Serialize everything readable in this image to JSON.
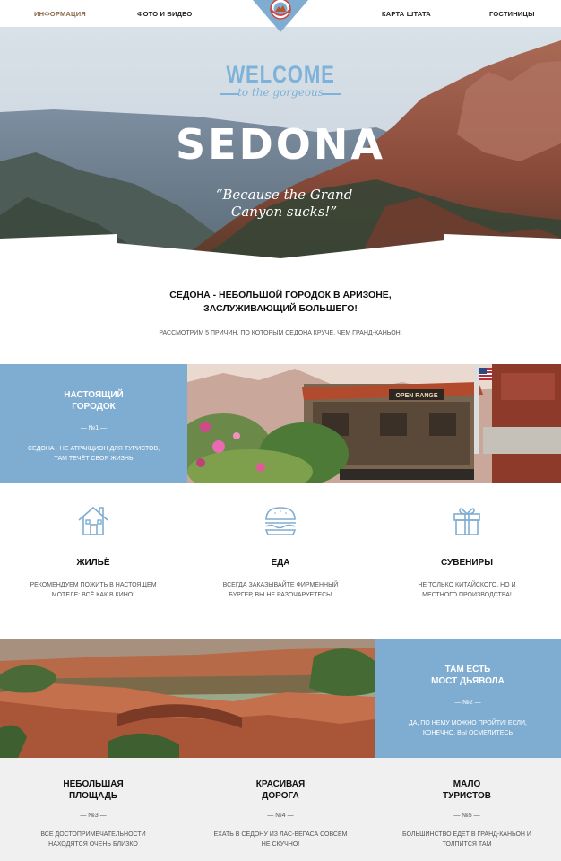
{
  "nav": {
    "items": [
      {
        "label": "ИНФОРМАЦИЯ",
        "active": true
      },
      {
        "label": "ФОТО И ВИДЕО",
        "active": false
      },
      {
        "label": "КАРТА ШТАТА",
        "active": false
      },
      {
        "label": "ГОСТИНИЦЫ",
        "active": false
      }
    ]
  },
  "hero": {
    "welcome": "WELCOME",
    "subtitle": "to the gorgeous",
    "title": "SEDONA",
    "quote": "“Because the Grand Canyon sucks!”"
  },
  "intro": {
    "title_line1": "СЕДОНА - НЕБОЛЬШОЙ ГОРОДОК В АРИЗОНЕ,",
    "title_line2": "ЗАСЛУЖИВАЮЩИЙ БОЛЬШЕГО!",
    "subtitle": "РАССМОТРИМ 5 ПРИЧИН, ПО КОТОРЫМ СЕДОНА КРУЧЕ, ЧЕМ ГРАНД-КАНЬОН!"
  },
  "reason1": {
    "title_line1": "НАСТОЯЩИЙ",
    "title_line2": "ГОРОДОК",
    "number": "— №1 —",
    "text_line1": "СЕДОНА - НЕ АТРАКЦИОН ДЛЯ ТУРИСТОВ,",
    "text_line2": "ТАМ ТЕЧЁТ СВОЯ ЖИЗНЬ",
    "sign": "OPEN RANGE"
  },
  "features": [
    {
      "icon": "house-icon",
      "title": "ЖИЛЬЁ",
      "line1": "РЕКОМЕНДУЕМ ПОЖИТЬ В НАСТОЯЩЕМ",
      "line2": "МОТЕЛЕ: ВСЁ КАК В КИНО!"
    },
    {
      "icon": "burger-icon",
      "title": "ЕДА",
      "line1": "ВСЕГДА ЗАКАЗЫВАЙТЕ ФИРМЕННЫЙ",
      "line2": "БУРГЕР, ВЫ НЕ РАЗОЧАРУЕТЕСЬ!"
    },
    {
      "icon": "gift-icon",
      "title": "СУВЕНИРЫ",
      "line1": "НЕ ТОЛЬКО КИТАЙСКОГО, НО И",
      "line2": "МЕСТНОГО ПРОИЗВОДСТВА!"
    }
  ],
  "reason2": {
    "title_line1": "ТАМ ЕСТЬ",
    "title_line2": "МОСТ ДЬЯВОЛА",
    "number": "— №2 —",
    "text_line1": "ДА, ПО НЕМУ МОЖНО ПРОЙТИ! ЕСЛИ,",
    "text_line2": "КОНЕЧНО, ВЫ ОСМЕЛИТЕСЬ"
  },
  "bottom": [
    {
      "title_line1": "НЕБОЛЬШАЯ",
      "title_line2": "ПЛОЩАДЬ",
      "number": "— №3 —",
      "line1": "ВСЕ ДОСТОПРИМЕЧАТЕЛЬНОСТИ",
      "line2": "НАХОДЯТСЯ ОЧЕНЬ БЛИЗКО"
    },
    {
      "title_line1": "КРАСИВАЯ",
      "title_line2": "ДОРОГА",
      "number": "— №4 —",
      "line1": "ЕХАТЬ В СЕДОНУ ИЗ ЛАС-ВЕГАСА СОВСЕМ",
      "line2": "НЕ СКУЧНО!"
    },
    {
      "title_line1": "МАЛО",
      "title_line2": "ТУРИСТОВ",
      "number": "— №5 —",
      "line1": "БОЛЬШИНСТВО ЕДЕТ В ГРАНД-КАНЬОН И",
      "line2": "ТОЛПИТСЯ ТАМ"
    }
  ],
  "colors": {
    "accent": "#7fadd2",
    "nav_active": "#8b6a4b",
    "bottom_bg": "#f0f0f0"
  }
}
